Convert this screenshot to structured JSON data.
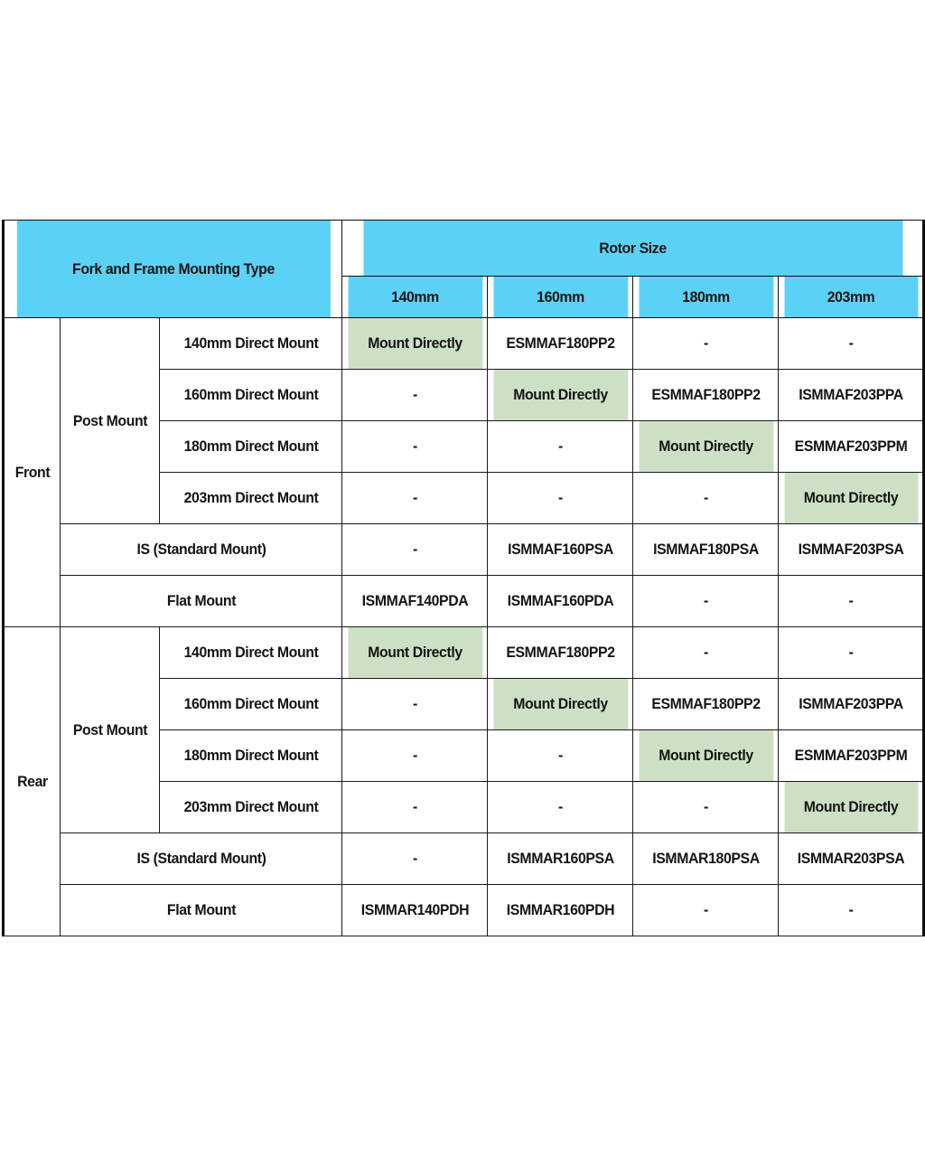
{
  "table": {
    "header": {
      "left_title": "Fork and Frame Mounting Type",
      "rotor_group": "Rotor Size",
      "rotor_sizes": [
        "140mm",
        "160mm",
        "180mm",
        "203mm"
      ]
    },
    "labels": {
      "mount_directly": "Mount Directly",
      "dash": "-",
      "post_mount": "Post Mount",
      "is_standard_mount": "IS (Standard Mount)",
      "flat_mount": "Flat Mount",
      "front": "Front",
      "rear": "Rear"
    },
    "colors": {
      "header_blue": "#5bd2f5",
      "highlight_green": "#cde0c5",
      "border": "#1a1a1a",
      "text": "#141414"
    },
    "sections": [
      {
        "side": "Front",
        "group": "Post Mount",
        "post_rows": [
          {
            "type": "140mm Direct Mount",
            "cells": [
              "Mount Directly",
              "ESMMAF180PP2",
              "-",
              "-"
            ],
            "highlight": [
              true,
              false,
              false,
              false
            ]
          },
          {
            "type": "160mm Direct Mount",
            "cells": [
              "-",
              "Mount Directly",
              "ESMMAF180PP2",
              "ISMMAF203PPA"
            ],
            "highlight": [
              false,
              true,
              false,
              false
            ]
          },
          {
            "type": "180mm Direct Mount",
            "cells": [
              "-",
              "-",
              "Mount Directly",
              "ESMMAF203PPM"
            ],
            "highlight": [
              false,
              false,
              true,
              false
            ]
          },
          {
            "type": "203mm Direct Mount",
            "cells": [
              "-",
              "-",
              "-",
              "Mount Directly"
            ],
            "highlight": [
              false,
              false,
              false,
              true
            ]
          }
        ],
        "other_rows": [
          {
            "type": "IS (Standard Mount)",
            "cells": [
              "-",
              "ISMMAF160PSA",
              "ISMMAF180PSA",
              "ISMMAF203PSA"
            ],
            "highlight": [
              false,
              false,
              false,
              false
            ]
          },
          {
            "type": "Flat Mount",
            "cells": [
              "ISMMAF140PDA",
              "ISMMAF160PDA",
              "-",
              "-"
            ],
            "highlight": [
              false,
              false,
              false,
              false
            ]
          }
        ]
      },
      {
        "side": "Rear",
        "group": "Post Mount",
        "post_rows": [
          {
            "type": "140mm Direct Mount",
            "cells": [
              "Mount Directly",
              "ESMMAF180PP2",
              "-",
              "-"
            ],
            "highlight": [
              true,
              false,
              false,
              false
            ]
          },
          {
            "type": "160mm Direct Mount",
            "cells": [
              "-",
              "Mount Directly",
              "ESMMAF180PP2",
              "ISMMAF203PPA"
            ],
            "highlight": [
              false,
              true,
              false,
              false
            ]
          },
          {
            "type": "180mm Direct Mount",
            "cells": [
              "-",
              "-",
              "Mount Directly",
              "ESMMAF203PPM"
            ],
            "highlight": [
              false,
              false,
              true,
              false
            ]
          },
          {
            "type": "203mm Direct Mount",
            "cells": [
              "-",
              "-",
              "-",
              "Mount Directly"
            ],
            "highlight": [
              false,
              false,
              false,
              true
            ]
          }
        ],
        "other_rows": [
          {
            "type": "IS (Standard Mount)",
            "cells": [
              "-",
              "ISMMAR160PSA",
              "ISMMAR180PSA",
              "ISMMAR203PSA"
            ],
            "highlight": [
              false,
              false,
              false,
              false
            ]
          },
          {
            "type": "Flat Mount",
            "cells": [
              "ISMMAR140PDH",
              "ISMMAR160PDH",
              "-",
              "-"
            ],
            "highlight": [
              false,
              false,
              false,
              false
            ]
          }
        ]
      }
    ]
  }
}
